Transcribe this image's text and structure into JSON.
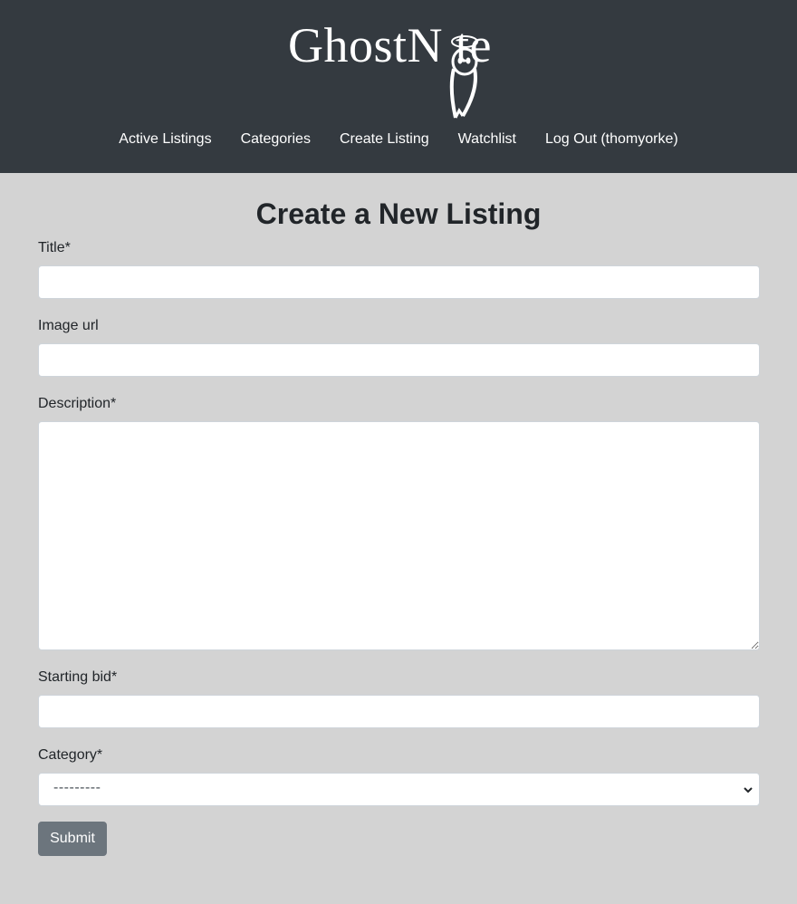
{
  "header": {
    "logo_text": "GhostN te",
    "nav": [
      {
        "label": "Active Listings"
      },
      {
        "label": "Categories"
      },
      {
        "label": "Create Listing"
      },
      {
        "label": "Watchlist"
      },
      {
        "label": "Log Out (thomyorke)"
      }
    ]
  },
  "form": {
    "title": "Create a New Listing",
    "fields": {
      "title_label": "Title*",
      "title_value": "",
      "image_label": "Image url",
      "image_value": "",
      "description_label": "Description*",
      "description_value": "",
      "bid_label": "Starting bid*",
      "bid_value": "",
      "category_label": "Category*",
      "category_value": "---------"
    },
    "submit_label": "Submit"
  },
  "colors": {
    "header_bg": "#343a40",
    "page_bg": "#d3d3d3",
    "button_bg": "#6c757d"
  }
}
